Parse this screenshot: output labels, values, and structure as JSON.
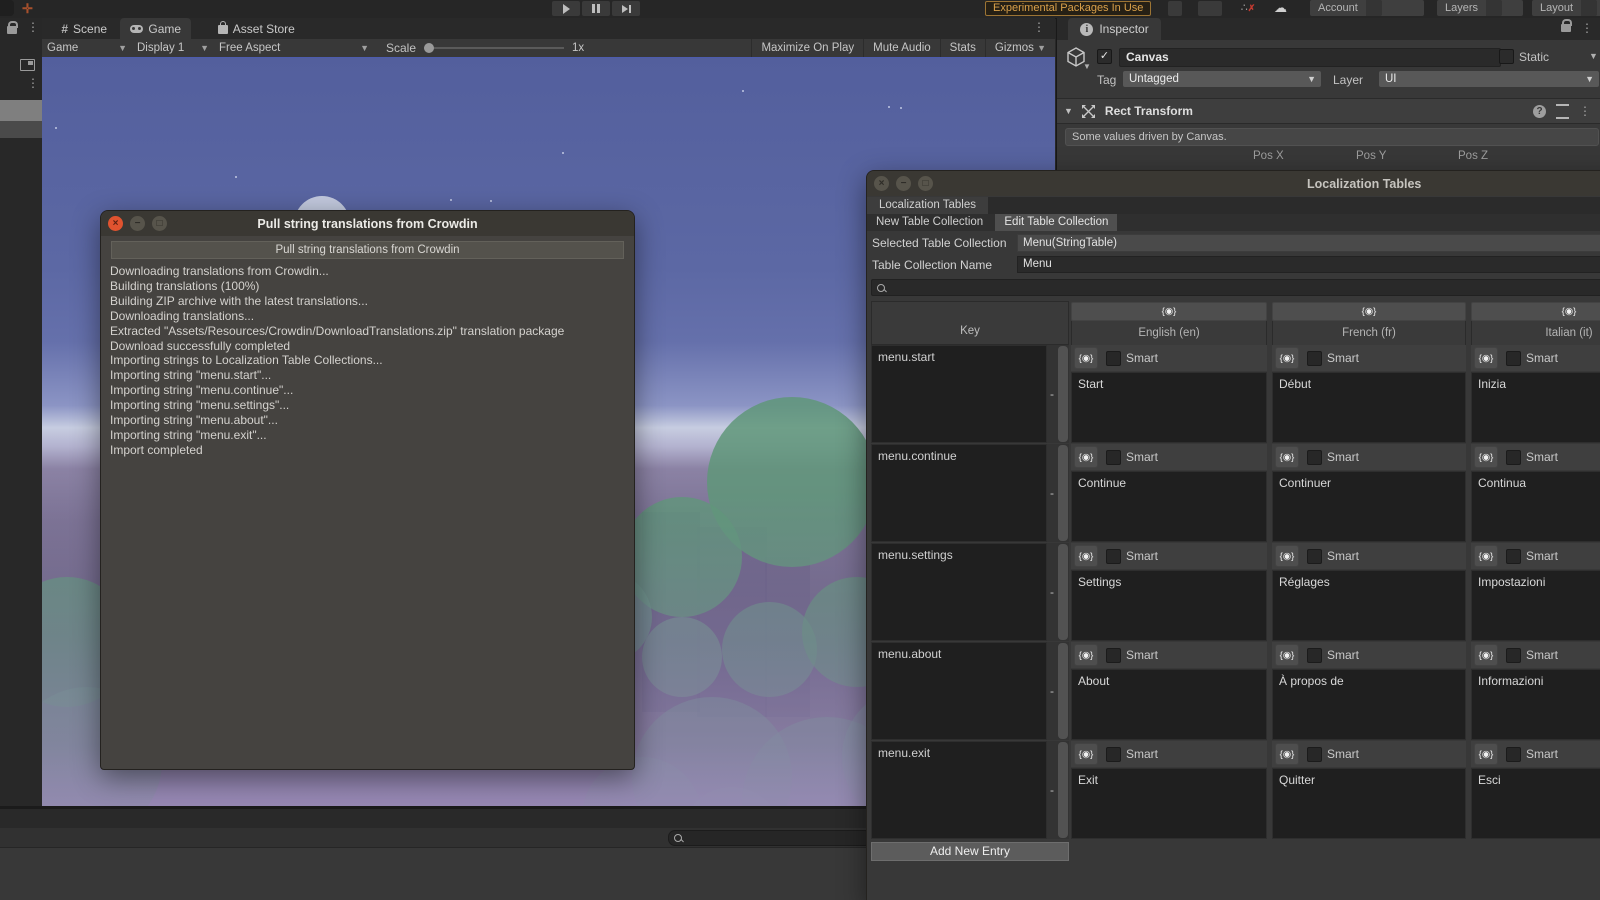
{
  "main_toolbar": {
    "experimental_badge": "Experimental Packages In Use",
    "account_label": "Account",
    "layers_label": "Layers",
    "layout_label": "Layout"
  },
  "game_panel": {
    "tabs": {
      "scene": "Scene",
      "game": "Game",
      "asset_store": "Asset Store"
    },
    "controls": {
      "display_target": "Game",
      "display": "Display 1",
      "aspect": "Free Aspect",
      "scale_label": "Scale",
      "scale_value": "1x",
      "maximize": "Maximize On Play",
      "mute": "Mute Audio",
      "stats": "Stats",
      "gizmos": "Gizmos"
    }
  },
  "inspector": {
    "tab": "Inspector",
    "object_name": "Canvas",
    "static_label": "Static",
    "tag_label": "Tag",
    "tag_value": "Untagged",
    "layer_label": "Layer",
    "layer_value": "UI",
    "component_title": "Rect Transform",
    "info_message": "Some values driven by Canvas.",
    "pos_labels": [
      "Pos X",
      "Pos Y",
      "Pos Z"
    ]
  },
  "crowdin_dialog": {
    "title": "Pull string translations from Crowdin",
    "action_button": "Pull string translations from Crowdin",
    "log_lines": [
      "Downloading translations from Crowdin...",
      "Building translations (100%)",
      "Building ZIP archive with the latest translations...",
      "Downloading translations...",
      "Extracted \"Assets/Resources/Crowdin/DownloadTranslations.zip\" translation package",
      "Download successfully completed",
      "Importing strings to Localization Table Collections...",
      "Importing string \"menu.start\"...",
      "Importing string \"menu.continue\"...",
      "Importing string \"menu.settings\"...",
      "Importing string \"menu.about\"...",
      "Importing string \"menu.exit\"...",
      "Import completed"
    ]
  },
  "localization": {
    "window_title": "Localization Tables",
    "tab": "Localization Tables",
    "new_button": "New Table Collection",
    "edit_button": "Edit Table Collection",
    "selected_label": "Selected Table Collection",
    "selected_value": "Menu(StringTable)",
    "name_label": "Table Collection Name",
    "name_value": "Menu",
    "smart_label": "Smart",
    "remove_label": "-",
    "add_button": "Add New Entry",
    "columns": [
      "Key",
      "English (en)",
      "French (fr)",
      "Italian (it)"
    ],
    "rows": [
      {
        "key": "menu.start",
        "values": [
          "Start",
          "Début",
          "Inizia"
        ]
      },
      {
        "key": "menu.continue",
        "values": [
          "Continue",
          "Continuer",
          "Continua"
        ]
      },
      {
        "key": "menu.settings",
        "values": [
          "Settings",
          "Réglages",
          "Impostazioni"
        ]
      },
      {
        "key": "menu.about",
        "values": [
          "About",
          "À propos de",
          "Informazioni"
        ]
      },
      {
        "key": "menu.exit",
        "values": [
          "Exit",
          "Quitter",
          "Esci"
        ]
      }
    ]
  },
  "icons": {
    "metadata_pin": "{◉}"
  },
  "colors": {
    "warning_accent": "#d9a04a",
    "close_button_active": "#e0532f",
    "panel_bg": "#383838",
    "cell_bg": "#1f1f1f"
  }
}
